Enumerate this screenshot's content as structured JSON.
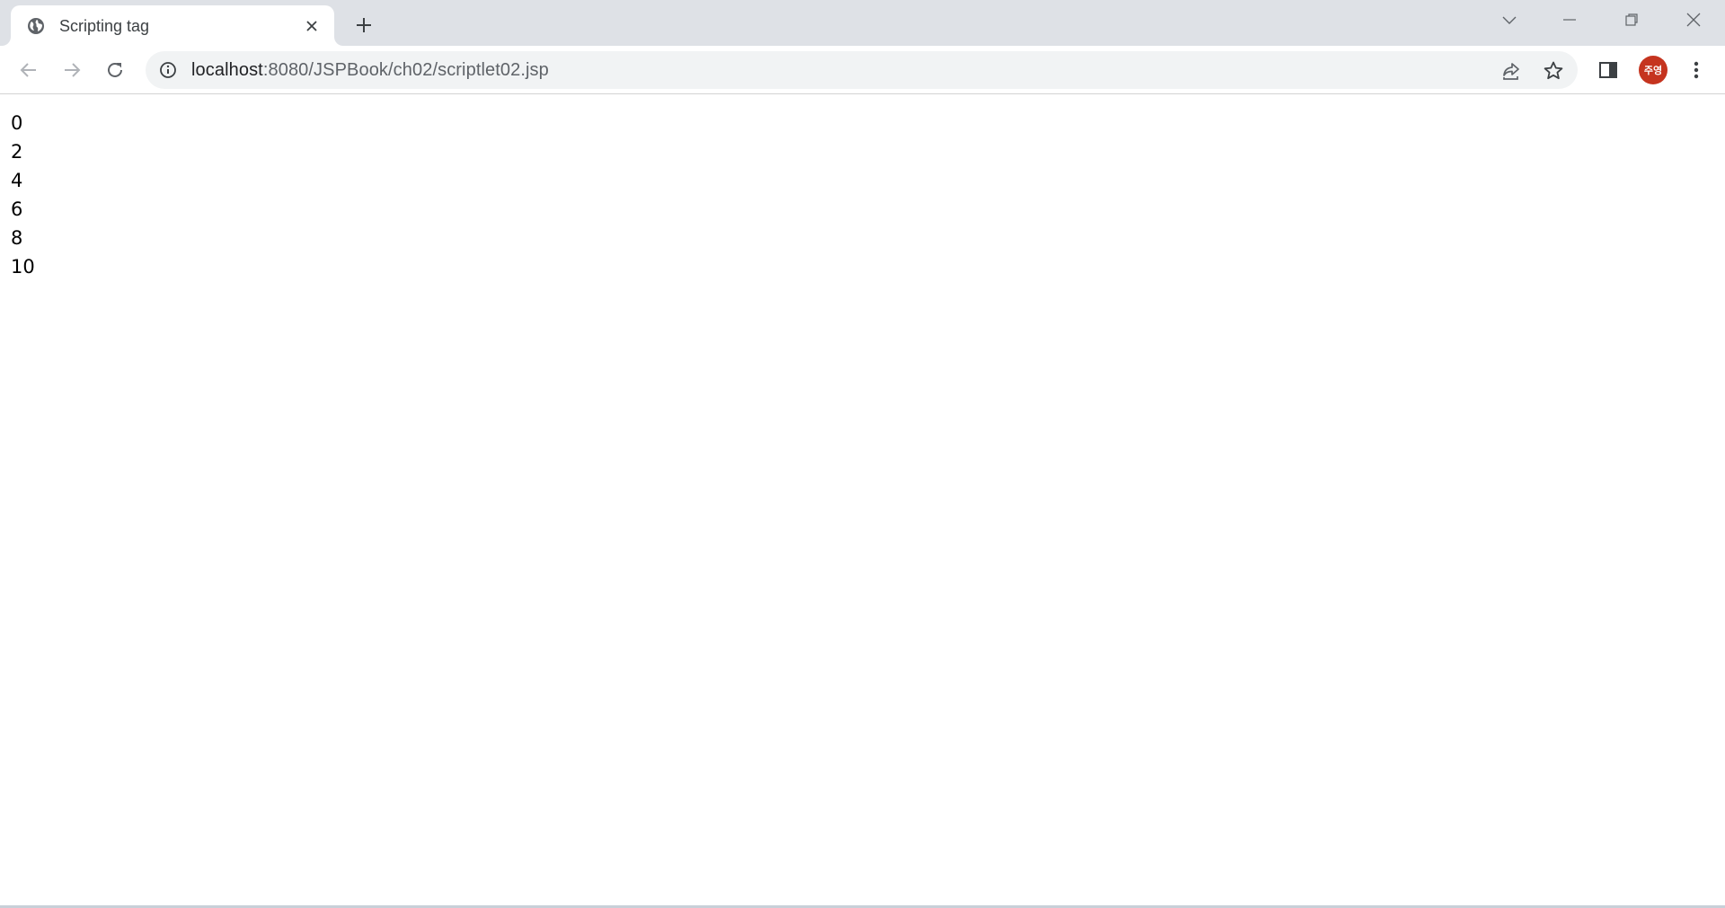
{
  "browser": {
    "tab": {
      "title": "Scripting tag",
      "favicon": "globe-icon"
    },
    "new_tab_icon": "plus-icon",
    "window_controls": [
      "tab-search-icon",
      "minimize-icon",
      "restore-icon",
      "close-icon"
    ],
    "address_bar": {
      "host": "localhost",
      "path": ":8080/JSPBook/ch02/scriptlet02.jsp"
    },
    "profile": {
      "initials": "주영",
      "color": "#c5341f"
    }
  },
  "page": {
    "lines": [
      "0",
      "2",
      "4",
      "6",
      "8",
      "10"
    ]
  }
}
